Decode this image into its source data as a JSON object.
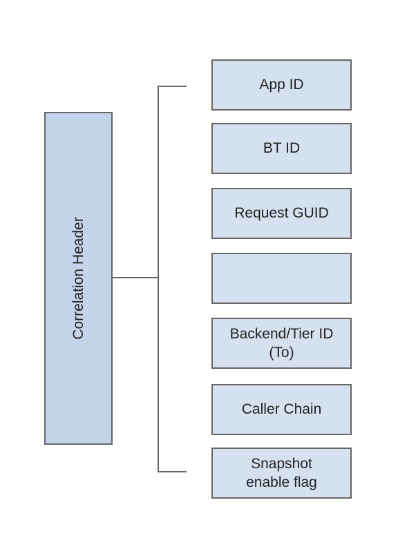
{
  "root": {
    "label": "Correlation Header"
  },
  "fields": [
    {
      "label": "App ID"
    },
    {
      "label": "BT ID"
    },
    {
      "label": "Request GUID"
    },
    {
      "label": ""
    },
    {
      "label": "Backend/Tier ID (To)"
    },
    {
      "label": "Caller Chain"
    },
    {
      "label": "Snapshot enable flag"
    }
  ],
  "colors": {
    "root_fill": "#c3d4ea",
    "field_fill": "#d5e1ee",
    "border": "#666666"
  }
}
